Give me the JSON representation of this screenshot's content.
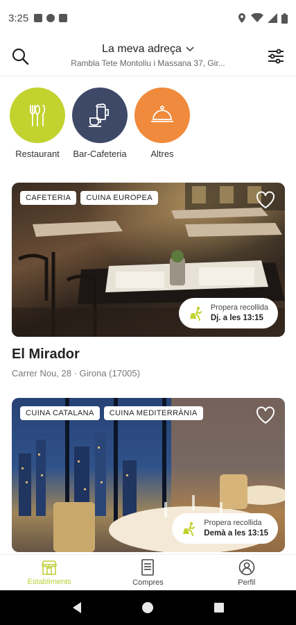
{
  "status_bar": {
    "time": "3:25"
  },
  "header": {
    "address_title": "La meva adreça",
    "address_sub": "Rambla Tete Montoliu i Massana 37, Gir..."
  },
  "categories": [
    {
      "label": "Restaurant",
      "color": "#c2d22f",
      "icon": "cutlery-icon"
    },
    {
      "label": "Bar-Cafeteria",
      "color": "#3e4968",
      "icon": "beer-coffee-icon"
    },
    {
      "label": "Altres",
      "color": "#f08a3c",
      "icon": "cloche-icon"
    }
  ],
  "cards": [
    {
      "tags": [
        "CAFETERIA",
        "CUINA EUROPEA"
      ],
      "pickup_label": "Propera recollida",
      "pickup_time": "Dj. a les 13:15",
      "name": "El Mirador",
      "address": "Carrer Nou, 28 · Girona (17005)"
    },
    {
      "tags": [
        "CUINA CATALANA",
        "CUINA MEDITERRÀNIA"
      ],
      "pickup_label": "Propera recollida",
      "pickup_time": "Demà a les 13:15"
    }
  ],
  "bottom_nav": [
    {
      "label": "Establiments",
      "active": true
    },
    {
      "label": "Compres",
      "active": false
    },
    {
      "label": "Perfil",
      "active": false
    }
  ],
  "colors": {
    "accent": "#bdd039"
  }
}
